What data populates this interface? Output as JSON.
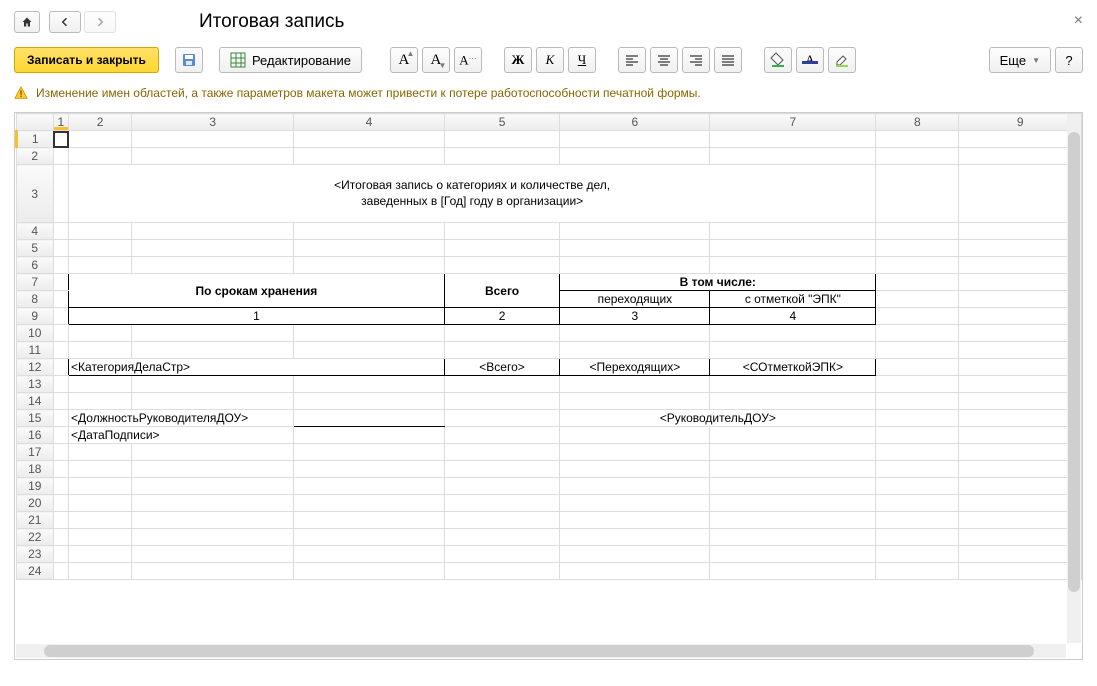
{
  "header": {
    "title": "Итоговая запись"
  },
  "toolbar": {
    "save_close": "Записать и закрыть",
    "edit_mode": "Редактирование",
    "more": "Еще"
  },
  "warning": "Изменение имен областей, а также параметров макета может привести к потере работоспособности печатной формы.",
  "sheet": {
    "col_labels": [
      "1",
      "2",
      "3",
      "4",
      "5",
      "6",
      "7",
      "8",
      "9"
    ],
    "row_labels": [
      "1",
      "2",
      "3",
      "4",
      "5",
      "6",
      "7",
      "8",
      "9",
      "10",
      "11",
      "12",
      "13",
      "14",
      "15",
      "16",
      "17",
      "18",
      "19",
      "20",
      "21",
      "22",
      "23",
      "24"
    ],
    "title_line1": "<Итоговая запись о категориях и количестве дел,",
    "title_line2": "заведенных в [Год] году в организации>",
    "table_header": {
      "storage": "По срокам хранения",
      "total": "Всего",
      "including": "В том числе:",
      "transferring": "переходящих",
      "epk": "с отметкой \"ЭПК\""
    },
    "table_nums": {
      "c1": "1",
      "c2": "2",
      "c3": "3",
      "c4": "4"
    },
    "data_row": {
      "category": "<КатегорияДелаСтр>",
      "total": "<Всего>",
      "transferring": "<Переходящих>",
      "epk": "<СОтметкойЭПК>"
    },
    "footer": {
      "position": "<ДолжностьРуководителяДОУ>",
      "head": "<РуководительДОУ>",
      "date": "<ДатаПодписи>"
    }
  }
}
